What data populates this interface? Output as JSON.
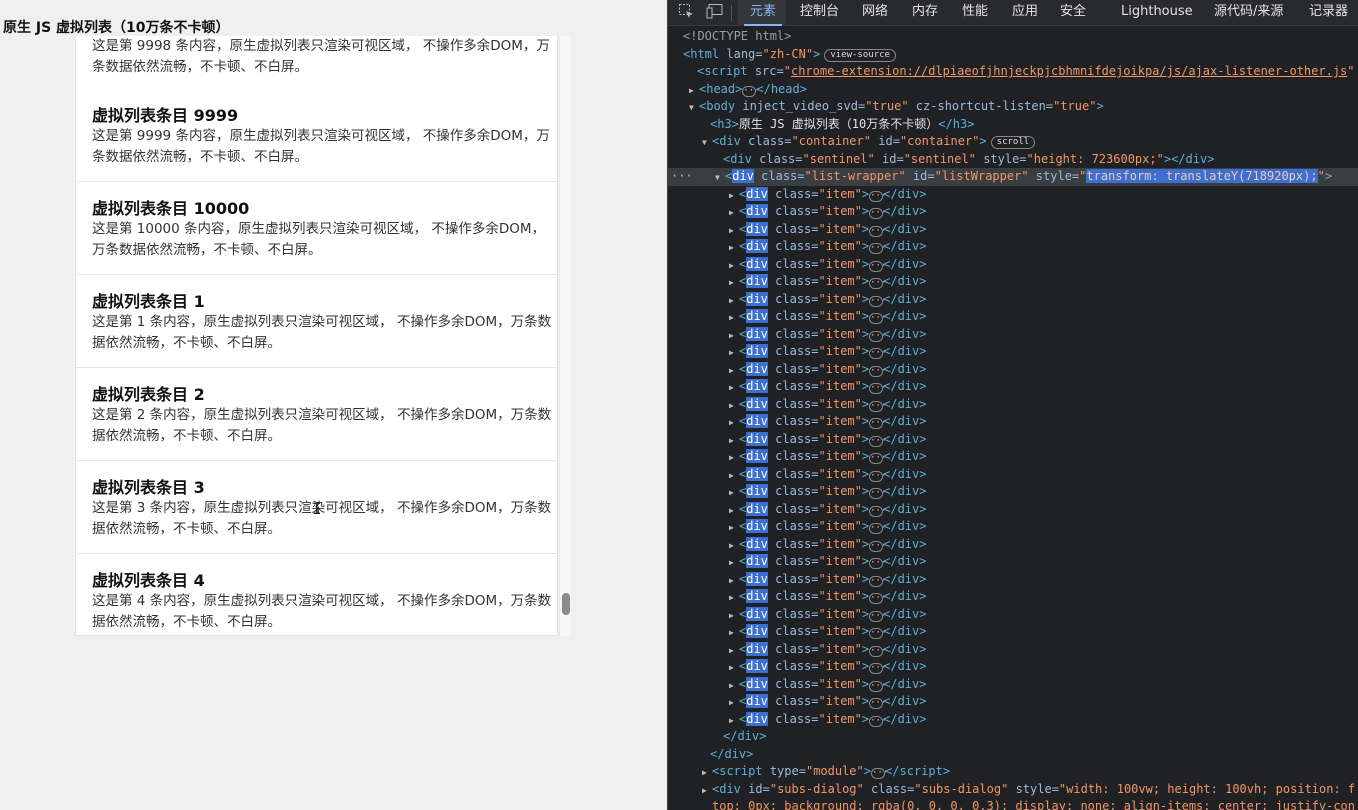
{
  "page": {
    "title": "原生 JS 虚拟列表（10万条不卡顿）",
    "items": [
      {
        "title": "",
        "desc": "这是第 9998 条内容，原生虚拟列表只渲染可视区域， 不操作多余DOM，万条数据依然流畅，不卡顿、不白屏。"
      },
      {
        "title": "虚拟列表条目 9999",
        "desc": "这是第 9999 条内容，原生虚拟列表只渲染可视区域， 不操作多余DOM，万条数据依然流畅，不卡顿、不白屏。"
      },
      {
        "title": "虚拟列表条目 10000",
        "desc": "这是第 10000 条内容，原生虚拟列表只渲染可视区域， 不操作多余DOM，万条数据依然流畅，不卡顿、不白屏。"
      },
      {
        "title": "虚拟列表条目 1",
        "desc": "这是第 1 条内容，原生虚拟列表只渲染可视区域， 不操作多余DOM，万条数据依然流畅，不卡顿、不白屏。"
      },
      {
        "title": "虚拟列表条目 2",
        "desc": "这是第 2 条内容，原生虚拟列表只渲染可视区域， 不操作多余DOM，万条数据依然流畅，不卡顿、不白屏。"
      },
      {
        "title": "虚拟列表条目 3",
        "desc": "这是第 3 条内容，原生虚拟列表只渲染可视区域， 不操作多余DOM，万条数据依然流畅，不卡顿、不白屏。"
      },
      {
        "title": "虚拟列表条目 4",
        "desc": "这是第 4 条内容，原生虚拟列表只渲染可视区域， 不操作多余DOM，万条数据依然流畅，不卡顿、不白屏。"
      }
    ],
    "scroll_position": 0.97
  },
  "devtools": {
    "tabs": [
      "元素",
      "控制台",
      "网络",
      "内存",
      "性能",
      "应用",
      "安全",
      "Lighthouse",
      "源代码/来源",
      "记录器"
    ],
    "active_tab": "元素",
    "icons": [
      "inspect-icon",
      "device-toggle-icon"
    ],
    "dom": {
      "doctype": "<!DOCTYPE html>",
      "html_tag": "html",
      "html_lang_attr": "lang",
      "html_lang_val": "zh-CN",
      "view_source": "view-source",
      "script_src_val": "chrome-extension://dlpiaeofjhnjeckpjcbhmnifdejoikpa/js/ajax-listener-other.js",
      "head": "head",
      "body_attr1": "inject_video_svd",
      "body_val1": "true",
      "body_attr2": "cz-shortcut-listen",
      "body_val2": "true",
      "h3_text": "原生 JS 虚拟列表（10万条不卡顿）",
      "container_class": "container",
      "container_id": "container",
      "scroll_pill": "scroll",
      "sentinel_class": "sentinel",
      "sentinel_id": "sentinel",
      "sentinel_style": "height: 723600px;",
      "wrapper_class": "list-wrapper",
      "wrapper_id": "listWrapper",
      "wrapper_style": "transform: translateY(718920px);",
      "item_class": "item",
      "item_count": 31,
      "script_type": "module",
      "subs_id": "subs-dialog",
      "subs_class": "subs-dialog",
      "subs_style_1": "width: 100vw; height: 100vh; position: f",
      "subs_style_2": "top: 0px; background: rgba(0, 0, 0, 0.3); display: none; align-items: center; justify-con"
    }
  }
}
